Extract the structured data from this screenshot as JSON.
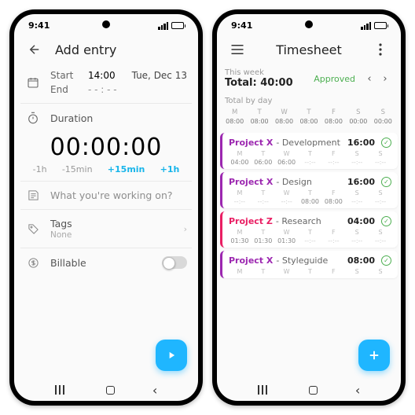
{
  "status_time": "9:41",
  "left": {
    "title": "Add entry",
    "start_lbl": "Start",
    "start_val": "14:00",
    "date": "Tue, Dec 13",
    "end_lbl": "End",
    "end_val": "- - : - -",
    "duration_lbl": "Duration",
    "duration": "00:00:00",
    "adj": [
      "-1h",
      "-15min",
      "+15min",
      "+1h"
    ],
    "note_placeholder": "What you're working on?",
    "tags_lbl": "Tags",
    "tags_val": "None",
    "billable_lbl": "Billable"
  },
  "right": {
    "title": "Timesheet",
    "week_lbl": "This week",
    "total_lbl": "Total: 40:00",
    "approved": "Approved",
    "total_by_day": "Total by day",
    "days": [
      "M",
      "T",
      "W",
      "T",
      "F",
      "S",
      "S"
    ],
    "day_totals": [
      "08:00",
      "08:00",
      "08:00",
      "08:00",
      "08:00",
      "00:00",
      "00:00"
    ],
    "cards": [
      {
        "cls": "px",
        "project": "Project X",
        "task": "Development",
        "total": "16:00",
        "vals": [
          "04:00",
          "06:00",
          "06:00",
          "--:--",
          "--:--",
          "--:--",
          "--:--"
        ]
      },
      {
        "cls": "px",
        "project": "Project X",
        "task": "Design",
        "total": "16:00",
        "vals": [
          "--:--",
          "--:--",
          "--:--",
          "08:00",
          "08:00",
          "--:--",
          "--:--"
        ]
      },
      {
        "cls": "pz",
        "project": "Project Z",
        "task": "Research",
        "total": "04:00",
        "vals": [
          "01:30",
          "01:30",
          "01:30",
          "--:--",
          "--:--",
          "--:--",
          "--:--"
        ]
      },
      {
        "cls": "px",
        "project": "Project X",
        "task": "Styleguide",
        "total": "08:00",
        "vals": [
          "",
          "",
          "",
          "",
          "",
          "",
          ""
        ]
      }
    ]
  }
}
